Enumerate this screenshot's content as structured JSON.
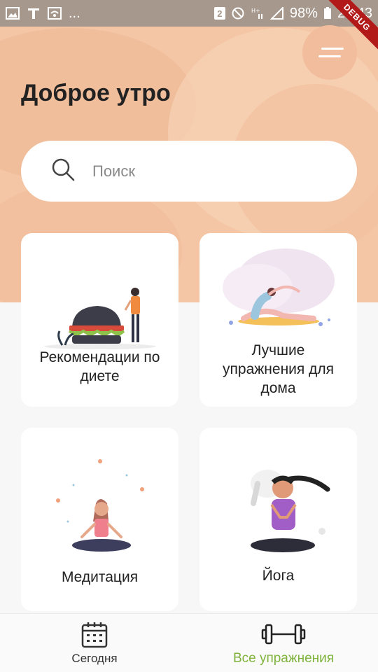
{
  "status_bar": {
    "ellipsis": "...",
    "sim_badge": "2",
    "battery": "98%",
    "time": "21:43",
    "debug_label": "DEBUG"
  },
  "header": {
    "greeting": "Доброе утро",
    "menu_icon": "hamburger-menu-icon"
  },
  "search": {
    "placeholder": "Поиск",
    "icon": "search-icon"
  },
  "cards": [
    {
      "label": "Рекомендации по диете",
      "illustration": "burger-diet-illustration"
    },
    {
      "label": "Лучшие упражнения для дома",
      "illustration": "home-stretching-illustration"
    },
    {
      "label": "Медитация",
      "illustration": "meditation-illustration"
    },
    {
      "label": "Йога",
      "illustration": "yoga-illustration"
    }
  ],
  "bottom_nav": {
    "items": [
      {
        "label": "Сегодня",
        "icon": "calendar-icon",
        "active": false
      },
      {
        "label": "Все упражнения",
        "icon": "dumbbell-icon",
        "active": true
      }
    ]
  },
  "colors": {
    "hero": "#f4c6a6",
    "accent": "#7fb33c",
    "statusbar": "#a6988c"
  }
}
